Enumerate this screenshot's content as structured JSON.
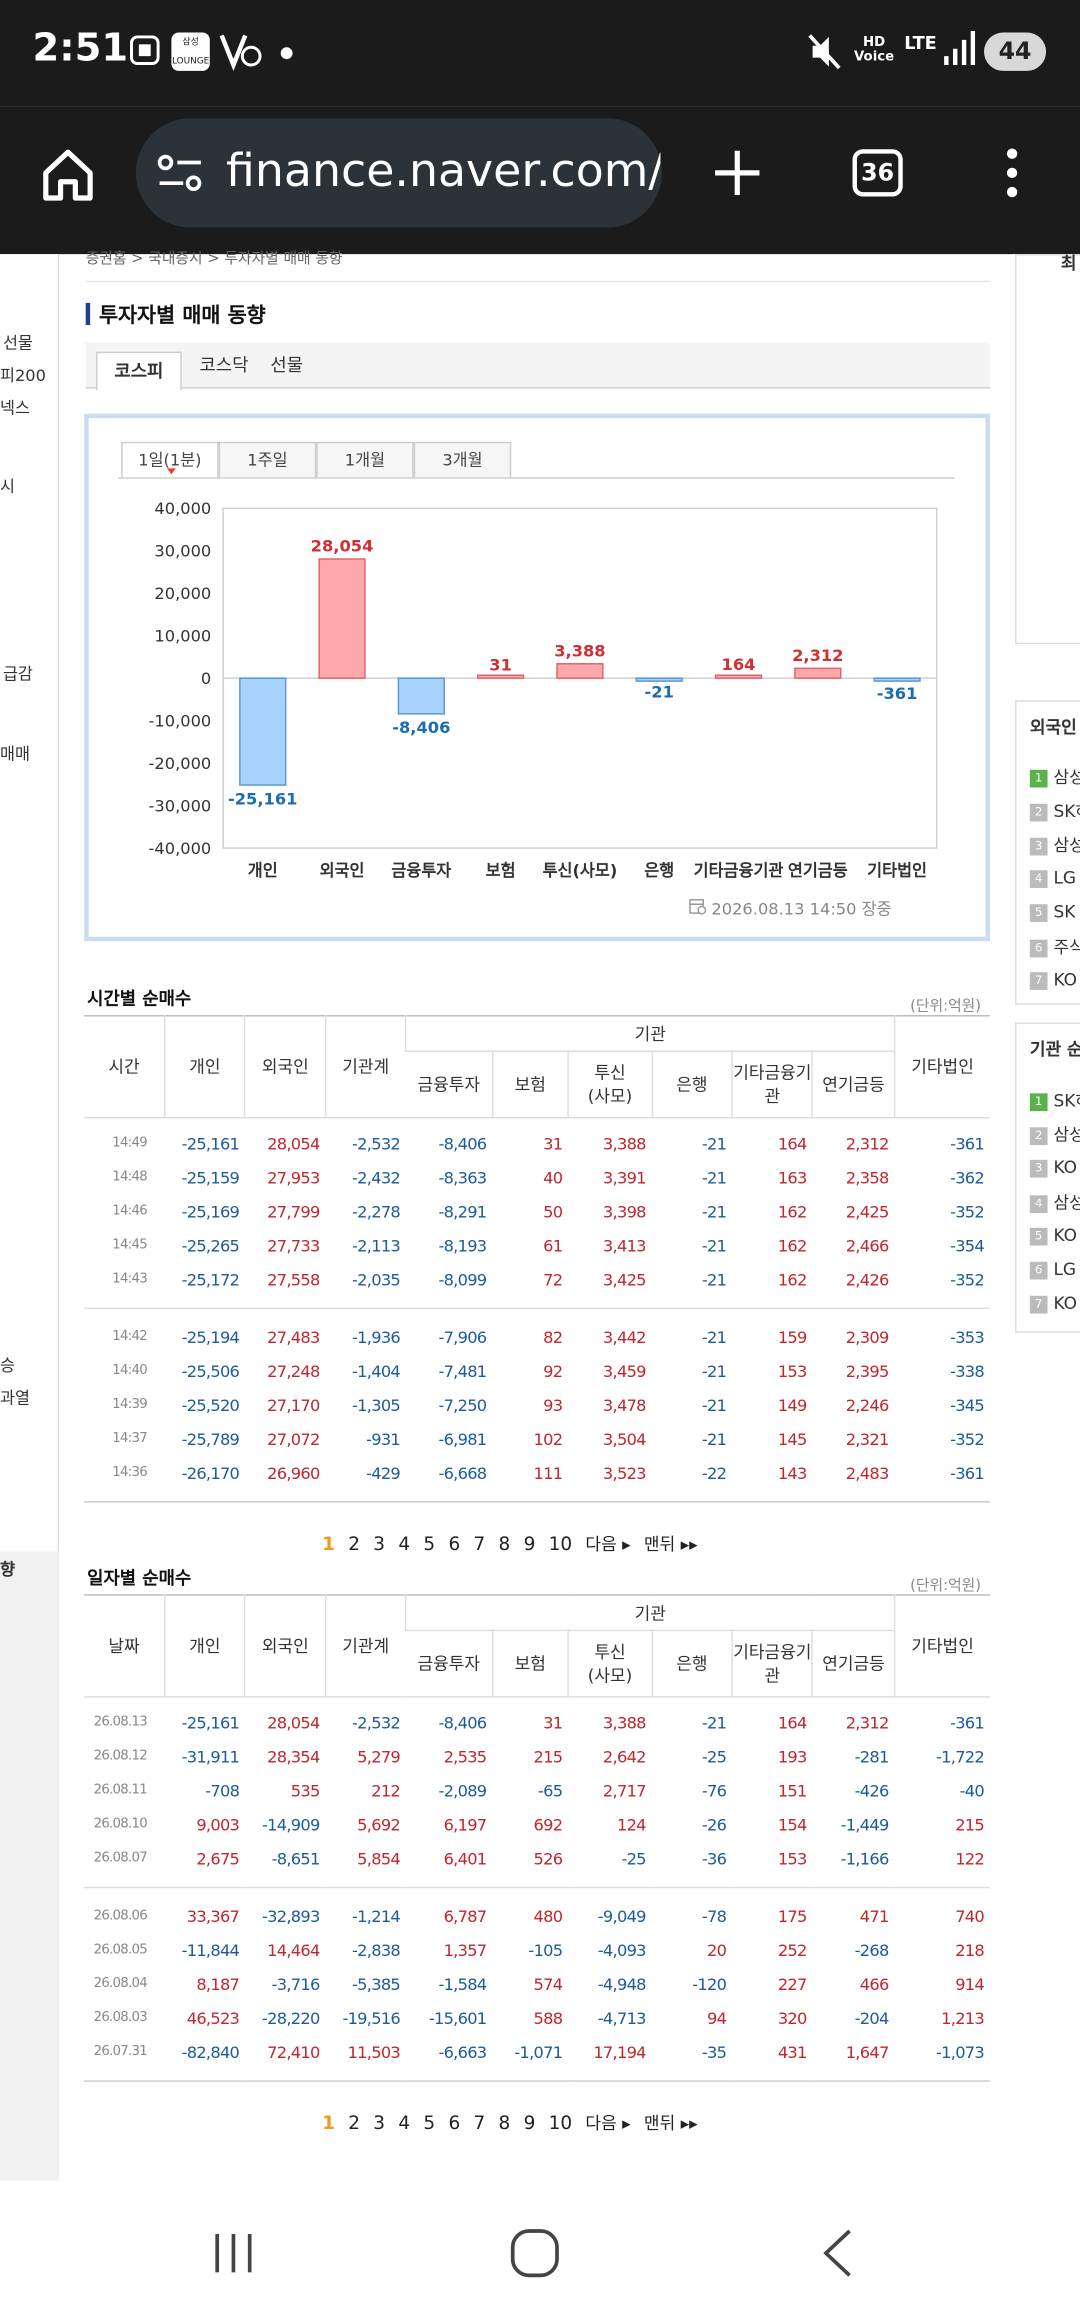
{
  "status": {
    "time": "2:51",
    "battery": "44",
    "network": "LTE",
    "hd": "HD\nVoice"
  },
  "browser": {
    "url": "finance.naver.com/sise",
    "tabs": "36"
  },
  "breadcrumb": "증권홈 > 국내증시 > 투자자별 매매 동향",
  "left_nav": [
    "선물",
    "피200",
    "넥스",
    "시",
    "",
    "급감",
    "",
    "매매",
    "",
    "",
    "승",
    "과열",
    "",
    "향"
  ],
  "right_nav": {
    "top": "최",
    "foreign_title": "외국인",
    "foreign": [
      "삼성",
      "SK하",
      "삼성",
      "LG",
      "SK",
      "주식",
      "KO"
    ],
    "inst_title": "기관 순",
    "inst": [
      "SK하",
      "삼성",
      "KO",
      "삼성",
      "KO",
      "LG",
      "KO"
    ]
  },
  "section_title": "투자자별 매매 동향",
  "market_tabs": [
    "코스피",
    "코스닥",
    "선물"
  ],
  "period_tabs": [
    "1일(1분)",
    "1주일",
    "1개월",
    "3개월"
  ],
  "chart_data": {
    "type": "bar",
    "categories": [
      "개인",
      "외국인",
      "금융투자",
      "보험",
      "투신(사모)",
      "은행",
      "기타금융기관",
      "연기금등",
      "기타법인"
    ],
    "values": [
      -25161,
      28054,
      -8406,
      31,
      3388,
      -21,
      164,
      2312,
      -361
    ],
    "labels": [
      "-25,161",
      "28,054",
      "-8,406",
      "31",
      "3,388",
      "-21",
      "164",
      "2,312",
      "-361"
    ],
    "yticks": [
      "40,000",
      "30,000",
      "20,000",
      "10,000",
      "0",
      "-10,000",
      "-20,000",
      "-30,000",
      "-40,000"
    ],
    "ylim": [
      -40000,
      40000
    ],
    "grid": false,
    "footnote": "2026.08.13 14:50 장중",
    "colors": {
      "pos_fill": "#ffa8ac",
      "pos_stroke": "#e0656b",
      "neg_fill": "#a8d3ff",
      "neg_stroke": "#5b97d4",
      "pos_text": "#d02f34",
      "neg_text": "#1b6bb5"
    }
  },
  "time_table": {
    "title": "시간별 순매수",
    "unit": "(단위:억원)",
    "h_first": "시간",
    "headers": [
      "개인",
      "외국인",
      "기관계"
    ],
    "group": "기관",
    "sub": [
      "금융투자",
      "보험",
      "투신\n(사모)",
      "은행",
      "기타금융기\n관",
      "연기금등"
    ],
    "last": "기타법인",
    "rows": [
      [
        "14:49",
        "-25,161",
        "28,054",
        "-2,532",
        "-8,406",
        "31",
        "3,388",
        "-21",
        "164",
        "2,312",
        "-361"
      ],
      [
        "14:48",
        "-25,159",
        "27,953",
        "-2,432",
        "-8,363",
        "40",
        "3,391",
        "-21",
        "163",
        "2,358",
        "-362"
      ],
      [
        "14:46",
        "-25,169",
        "27,799",
        "-2,278",
        "-8,291",
        "50",
        "3,398",
        "-21",
        "162",
        "2,425",
        "-352"
      ],
      [
        "14:45",
        "-25,265",
        "27,733",
        "-2,113",
        "-8,193",
        "61",
        "3,413",
        "-21",
        "162",
        "2,466",
        "-354"
      ],
      [
        "14:43",
        "-25,172",
        "27,558",
        "-2,035",
        "-8,099",
        "72",
        "3,425",
        "-21",
        "162",
        "2,426",
        "-352"
      ],
      [
        "14:42",
        "-25,194",
        "27,483",
        "-1,936",
        "-7,906",
        "82",
        "3,442",
        "-21",
        "159",
        "2,309",
        "-353"
      ],
      [
        "14:40",
        "-25,506",
        "27,248",
        "-1,404",
        "-7,481",
        "92",
        "3,459",
        "-21",
        "153",
        "2,395",
        "-338"
      ],
      [
        "14:39",
        "-25,520",
        "27,170",
        "-1,305",
        "-7,250",
        "93",
        "3,478",
        "-21",
        "149",
        "2,246",
        "-345"
      ],
      [
        "14:37",
        "-25,789",
        "27,072",
        "-931",
        "-6,981",
        "102",
        "3,504",
        "-21",
        "145",
        "2,321",
        "-352"
      ],
      [
        "14:36",
        "-26,170",
        "26,960",
        "-429",
        "-6,668",
        "111",
        "3,523",
        "-22",
        "143",
        "2,483",
        "-361"
      ]
    ]
  },
  "daily_table": {
    "title": "일자별 순매수",
    "unit": "(단위:억원)",
    "h_first": "날짜",
    "headers": [
      "개인",
      "외국인",
      "기관계"
    ],
    "group": "기관",
    "sub": [
      "금융투자",
      "보험",
      "투신\n(사모)",
      "은행",
      "기타금융기\n관",
      "연기금등"
    ],
    "last": "기타법인",
    "rows": [
      [
        "26.08.13",
        "-25,161",
        "28,054",
        "-2,532",
        "-8,406",
        "31",
        "3,388",
        "-21",
        "164",
        "2,312",
        "-361"
      ],
      [
        "26.08.12",
        "-31,911",
        "28,354",
        "5,279",
        "2,535",
        "215",
        "2,642",
        "-25",
        "193",
        "-281",
        "-1,722"
      ],
      [
        "26.08.11",
        "-708",
        "535",
        "212",
        "-2,089",
        "-65",
        "2,717",
        "-76",
        "151",
        "-426",
        "-40"
      ],
      [
        "26.08.10",
        "9,003",
        "-14,909",
        "5,692",
        "6,197",
        "692",
        "124",
        "-26",
        "154",
        "-1,449",
        "215"
      ],
      [
        "26.08.07",
        "2,675",
        "-8,651",
        "5,854",
        "6,401",
        "526",
        "-25",
        "-36",
        "153",
        "-1,166",
        "122"
      ],
      [
        "26.08.06",
        "33,367",
        "-32,893",
        "-1,214",
        "6,787",
        "480",
        "-9,049",
        "-78",
        "175",
        "471",
        "740"
      ],
      [
        "26.08.05",
        "-11,844",
        "14,464",
        "-2,838",
        "1,357",
        "-105",
        "-4,093",
        "20",
        "252",
        "-268",
        "218"
      ],
      [
        "26.08.04",
        "8,187",
        "-3,716",
        "-5,385",
        "-1,584",
        "574",
        "-4,948",
        "-120",
        "227",
        "466",
        "914"
      ],
      [
        "26.08.03",
        "46,523",
        "-28,220",
        "-19,516",
        "-15,601",
        "588",
        "-4,713",
        "94",
        "320",
        "-204",
        "1,213"
      ],
      [
        "26.07.31",
        "-82,840",
        "72,410",
        "11,503",
        "-6,663",
        "-1,071",
        "17,194",
        "-35",
        "431",
        "1,647",
        "-1,073"
      ]
    ]
  },
  "pager": {
    "pages": [
      "1",
      "2",
      "3",
      "4",
      "5",
      "6",
      "7",
      "8",
      "9",
      "10"
    ],
    "next": "다음",
    "last": "맨뒤"
  }
}
